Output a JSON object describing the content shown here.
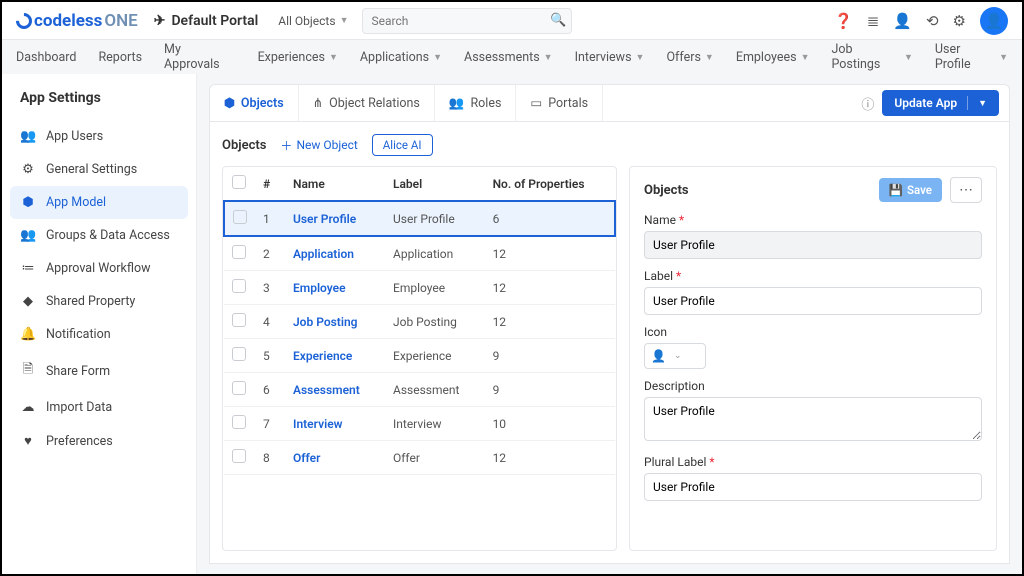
{
  "brand": {
    "code": "codeless",
    "one": "ONE"
  },
  "portal": "Default Portal",
  "allObjects": "All Objects",
  "searchPlaceholder": "Search",
  "nav": [
    "Dashboard",
    "Reports",
    "My Approvals",
    "Experiences",
    "Applications",
    "Assessments",
    "Interviews",
    "Offers",
    "Employees",
    "Job Postings",
    "User Profile"
  ],
  "navCaret": [
    false,
    false,
    false,
    true,
    true,
    true,
    true,
    true,
    true,
    true,
    true
  ],
  "sidebarTitle": "App Settings",
  "sidebar": [
    {
      "label": "App Users",
      "icon": "👥"
    },
    {
      "label": "General Settings",
      "icon": "⚙"
    },
    {
      "label": "App Model",
      "icon": "⬢",
      "active": true
    },
    {
      "label": "Groups & Data Access",
      "icon": "👥"
    },
    {
      "label": "Approval Workflow",
      "icon": "≔"
    },
    {
      "label": "Shared Property",
      "icon": "◆"
    },
    {
      "label": "Notification",
      "icon": "🔔"
    },
    {
      "label": "Share Form",
      "icon": "🗎"
    },
    {
      "label": "Import Data",
      "icon": "☁"
    },
    {
      "label": "Preferences",
      "icon": "♥"
    }
  ],
  "tabs": [
    {
      "label": "Objects",
      "icon": "⬢",
      "active": true
    },
    {
      "label": "Object Relations",
      "icon": "⋔"
    },
    {
      "label": "Roles",
      "icon": "👥"
    },
    {
      "label": "Portals",
      "icon": "▭"
    }
  ],
  "updateBtn": "Update App",
  "objHeader": "Objects",
  "newObj": "New Object",
  "alice": "Alice AI",
  "cols": [
    "#",
    "Name",
    "Label",
    "No. of Properties"
  ],
  "rows": [
    {
      "n": "1",
      "name": "User Profile",
      "label": "User Profile",
      "props": "6",
      "sel": true
    },
    {
      "n": "2",
      "name": "Application",
      "label": "Application",
      "props": "12"
    },
    {
      "n": "3",
      "name": "Employee",
      "label": "Employee",
      "props": "12"
    },
    {
      "n": "4",
      "name": "Job Posting",
      "label": "Job Posting",
      "props": "12"
    },
    {
      "n": "5",
      "name": "Experience",
      "label": "Experience",
      "props": "9"
    },
    {
      "n": "6",
      "name": "Assessment",
      "label": "Assessment",
      "props": "9"
    },
    {
      "n": "7",
      "name": "Interview",
      "label": "Interview",
      "props": "10"
    },
    {
      "n": "8",
      "name": "Offer",
      "label": "Offer",
      "props": "12"
    }
  ],
  "details": {
    "heading": "Objects",
    "save": "Save",
    "fields": {
      "nameLabel": "Name",
      "nameVal": "User Profile",
      "labelLabel": "Label",
      "labelVal": "User Profile",
      "iconLabel": "Icon",
      "descLabel": "Description",
      "descVal": "User Profile",
      "pluralLabel": "Plural Label",
      "pluralVal": "User Profile"
    }
  }
}
